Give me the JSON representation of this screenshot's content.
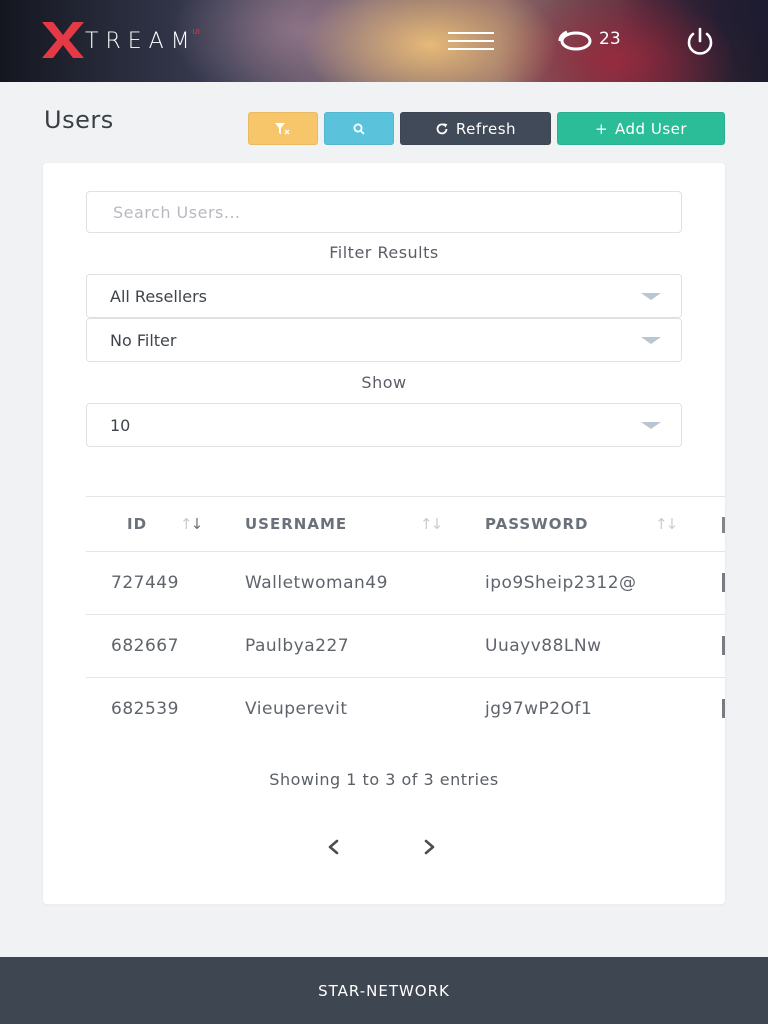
{
  "header": {
    "logo_text": "TREAM",
    "logo_superscript": "UI",
    "menu_icon": "hamburger-icon",
    "connections_icon": "connections-icon",
    "connections_count": "23",
    "power_icon": "power-icon"
  },
  "page": {
    "title": "Users"
  },
  "toolbar": {
    "filter_icon": "filter-clear-icon",
    "search_icon": "search-icon",
    "refresh_icon": "refresh-icon",
    "refresh_label": "Refresh",
    "add_icon": "plus-icon",
    "add_label": "Add User"
  },
  "filters": {
    "search_placeholder": "Search Users...",
    "filter_results_label": "Filter Results",
    "reseller_selected": "All Resellers",
    "filter_selected": "No Filter",
    "show_label": "Show",
    "show_selected": "10"
  },
  "table": {
    "columns": [
      "ID",
      "USERNAME",
      "PASSWORD"
    ],
    "rows": [
      {
        "id": "727449",
        "username": "Walletwoman49",
        "password": "ipo9Sheip2312@"
      },
      {
        "id": "682667",
        "username": "Paulbya227",
        "password": "Uuayv88LNw"
      },
      {
        "id": "682539",
        "username": "Vieuperevit",
        "password": "jg97wP2Of1"
      }
    ]
  },
  "pagination": {
    "info": "Showing 1 to 3 of 3 entries",
    "prev_icon": "chevron-left-icon",
    "next_icon": "chevron-right-icon"
  },
  "footer": {
    "text": "STAR-NETWORK"
  },
  "colors": {
    "filter_button": "#f7c66b",
    "search_button": "#5bc2dc",
    "refresh_button": "#414a58",
    "add_button": "#2bbc98",
    "logo_accent": "#e63946",
    "footer": "#3e4652"
  }
}
